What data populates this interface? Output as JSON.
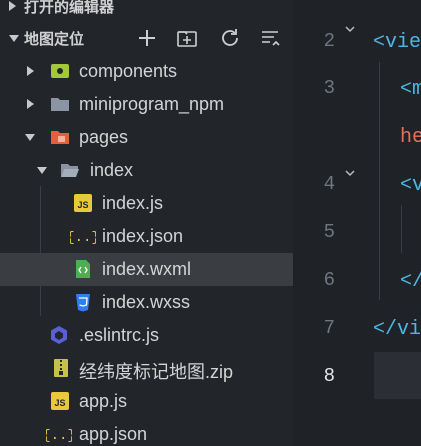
{
  "explorer": {
    "open_editors_title": "打开的编辑器",
    "project_title": "地图定位",
    "toolbar": {
      "new_file": "new-file",
      "new_folder": "new-folder",
      "refresh": "refresh",
      "collapse": "collapse-all"
    },
    "tree": [
      {
        "label": "components",
        "icon": "components-folder-icon",
        "color": "#a3c93a"
      },
      {
        "label": "miniprogram_npm",
        "icon": "folder-icon",
        "color": "#8a94a3"
      },
      {
        "label": "pages",
        "icon": "pages-folder-icon",
        "color": "#e2603b"
      },
      {
        "label": "index",
        "icon": "folder-open-icon",
        "color": "#8a94a3"
      },
      {
        "label": "index.js",
        "icon": "js-file-icon",
        "color": "#e9c83a"
      },
      {
        "label": "index.json",
        "icon": "json-file-icon",
        "color": "#e9c83a"
      },
      {
        "label": "index.wxml",
        "icon": "wxml-file-icon",
        "color": "#4caf50",
        "selected": true
      },
      {
        "label": "index.wxss",
        "icon": "css-file-icon",
        "color": "#2f7ff0"
      },
      {
        "label": ".eslintrc.js",
        "icon": "eslint-file-icon",
        "color": "#5b5fd6"
      },
      {
        "label": "经纬度标记地图.zip",
        "icon": "zip-file-icon",
        "color": "#c9c24a"
      },
      {
        "label": "app.js",
        "icon": "js-file-icon",
        "color": "#e9c83a"
      },
      {
        "label": "app.json",
        "icon": "json-file-icon",
        "color": "#e9c83a"
      }
    ]
  },
  "editor": {
    "line_numbers": [
      "2",
      "3",
      "",
      "4",
      "5",
      "6",
      "7",
      "8"
    ],
    "active_line": "8",
    "code": {
      "l2": "<vie",
      "l3": "<m",
      "l3b": "he",
      "l4": "<v",
      "l6": "</",
      "l7": "</vi"
    }
  }
}
